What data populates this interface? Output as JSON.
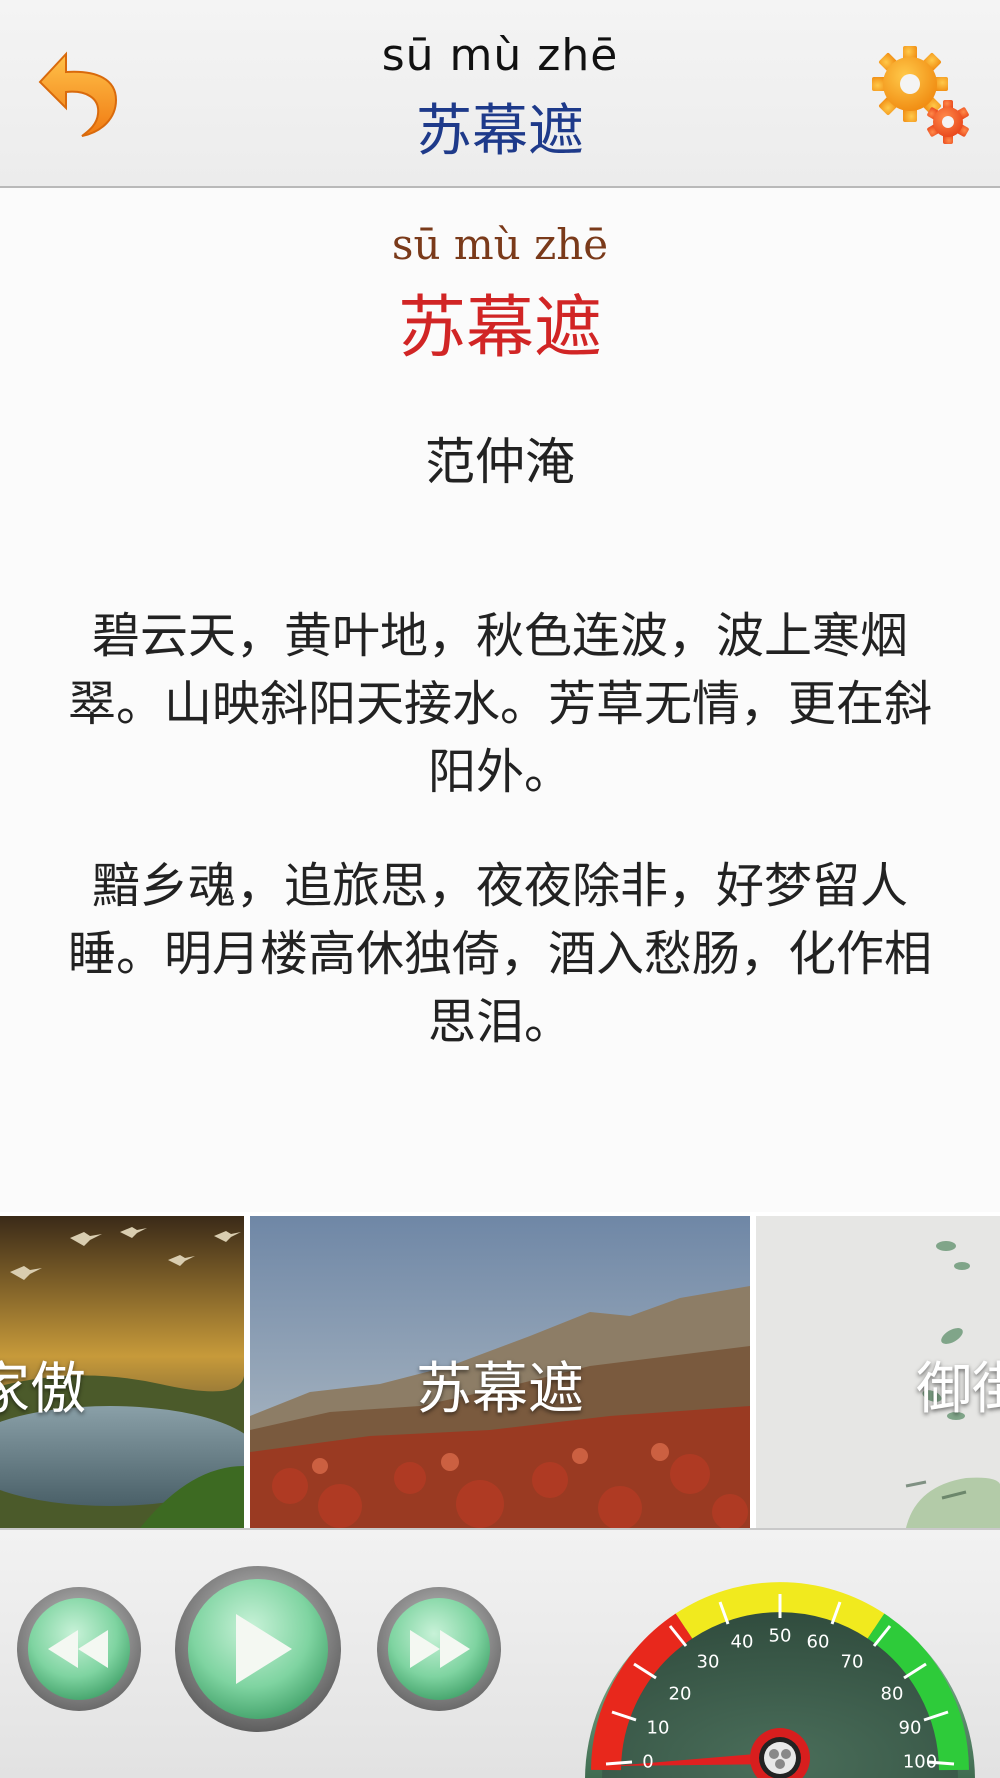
{
  "header": {
    "pinyin": "sū mù zhē",
    "title": "苏幕遮"
  },
  "poem": {
    "pinyin": "sū mù zhē",
    "title": "苏幕遮",
    "author": "范仲淹",
    "stanzas": [
      "碧云天，黄叶地，秋色连波，波上寒烟翠。山映斜阳天接水。芳草无情，更在斜阳外。",
      "黯乡魂，追旅思，夜夜除非，好梦留人睡。明月楼高休独倚，酒入愁肠，化作相思泪。"
    ]
  },
  "carousel": {
    "slides": [
      {
        "label": "家傲"
      },
      {
        "label": "苏幕遮"
      },
      {
        "label": "御街"
      }
    ]
  },
  "speed_gauge": {
    "labels": [
      "0",
      "10",
      "20",
      "30",
      "40",
      "50",
      "60",
      "70",
      "80",
      "90",
      "100"
    ],
    "value": 0
  },
  "colors": {
    "header_title": "#1e3a8a",
    "poem_title": "#d12525",
    "poem_pinyin": "#7a3a1a",
    "accent_orange": "#f59a1c",
    "control_green": "#7fd4a1"
  }
}
